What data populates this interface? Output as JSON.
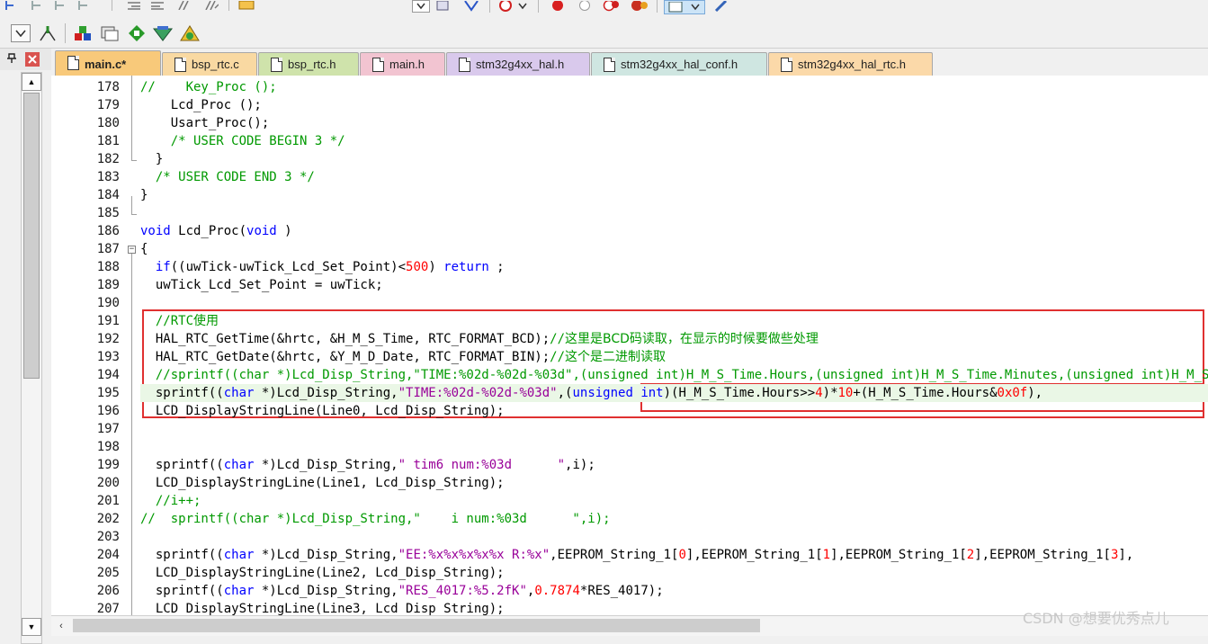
{
  "tabs": [
    {
      "label": "main.c*",
      "color": "#f8c97a",
      "active": true
    },
    {
      "label": "bsp_rtc.c",
      "color": "#f9d9a2",
      "active": false
    },
    {
      "label": "bsp_rtc.h",
      "color": "#cfe3ab",
      "active": false
    },
    {
      "label": "main.h",
      "color": "#f2c4d1",
      "active": false
    },
    {
      "label": "stm32g4xx_hal.h",
      "color": "#d9c9ec",
      "active": false
    },
    {
      "label": "stm32g4xx_hal_conf.h",
      "color": "#cfe6e1",
      "active": false
    },
    {
      "label": "stm32g4xx_hal_rtc.h",
      "color": "#fbd9a9",
      "active": false
    }
  ],
  "lines": [
    {
      "n": "178",
      "html": "<span class=\"cm\">//    Key_Proc ();</span>"
    },
    {
      "n": "179",
      "html": "    Lcd_Proc ();"
    },
    {
      "n": "180",
      "html": "    Usart_Proc();"
    },
    {
      "n": "181",
      "html": "    <span class=\"cm\">/* USER CODE BEGIN 3 */</span>"
    },
    {
      "n": "182",
      "html": "  }"
    },
    {
      "n": "183",
      "html": "  <span class=\"cm\">/* USER CODE END 3 */</span>"
    },
    {
      "n": "184",
      "html": "}"
    },
    {
      "n": "185",
      "html": ""
    },
    {
      "n": "186",
      "html": "<span class=\"kw\">void</span> Lcd_Proc(<span class=\"kw\">void</span> )"
    },
    {
      "n": "187",
      "html": "{"
    },
    {
      "n": "188",
      "html": "  <span class=\"kw\">if</span>((uwTick-uwTick_Lcd_Set_Point)&lt;<span class=\"num\">500</span>) <span class=\"kw\">return</span> ;"
    },
    {
      "n": "189",
      "html": "  uwTick_Lcd_Set_Point = uwTick;"
    },
    {
      "n": "190",
      "html": ""
    },
    {
      "n": "191",
      "html": "  <span class=\"cm\">//RTC<span class=\"cn\">使用</span></span>"
    },
    {
      "n": "192",
      "html": "  HAL_RTC_GetTime(&amp;hrtc, &amp;H_M_S_Time, RTC_FORMAT_BCD);<span class=\"cm\">//<span class=\"cn\">这里是BCD码读取，在显示的时候要做些处理</span></span>"
    },
    {
      "n": "193",
      "html": "  HAL_RTC_GetDate(&amp;hrtc, &amp;Y_M_D_Date, RTC_FORMAT_BIN);<span class=\"cm\">//<span class=\"cn\">这个是二进制读取</span></span>"
    },
    {
      "n": "194",
      "html": "  <span class=\"cm\">//sprintf((char *)Lcd_Disp_String,\"TIME:%02d-%02d-%03d\",(unsigned int)H_M_S_Time.Hours,(unsigned int)H_M_S_Time.Minutes,(unsigned int)H_M_S_Time.Seconds);</span>"
    },
    {
      "n": "195",
      "html": "  sprintf((<span class=\"kw\">char</span> *)Lcd_Disp_String,<span class=\"str\">\"TIME:%02d-%02d-%03d\"</span>,(<span class=\"kw\">unsigned int</span>)(H_M_S_Time.Hours&gt;&gt;<span class=\"num\">4</span>)*<span class=\"num\">10</span>+(H_M_S_Time.Hours&amp;<span class=\"num\">0x0f</span>),"
    },
    {
      "n": "196",
      "html": "  LCD_DisplayStringLine(Line0, Lcd_Disp_String);"
    },
    {
      "n": "197",
      "html": ""
    },
    {
      "n": "198",
      "html": ""
    },
    {
      "n": "199",
      "html": "  sprintf((<span class=\"kw\">char</span> *)Lcd_Disp_String,<span class=\"str\">\" tim6 num:%03d      \"</span>,i);"
    },
    {
      "n": "200",
      "html": "  LCD_DisplayStringLine(Line1, Lcd_Disp_String);"
    },
    {
      "n": "201",
      "html": "  <span class=\"cm\">//i++;</span>"
    },
    {
      "n": "202",
      "html": "<span class=\"cm\">//  sprintf((char *)Lcd_Disp_String,\"    i num:%03d      \",i);</span>"
    },
    {
      "n": "203",
      "html": ""
    },
    {
      "n": "204",
      "html": "  sprintf((<span class=\"kw\">char</span> *)Lcd_Disp_String,<span class=\"str\">\"EE:%x%x%x%x%x R:%x\"</span>,EEPROM_String_1[<span class=\"num\">0</span>],EEPROM_String_1[<span class=\"num\">1</span>],EEPROM_String_1[<span class=\"num\">2</span>],EEPROM_String_1[<span class=\"num\">3</span>],"
    },
    {
      "n": "205",
      "html": "  LCD_DisplayStringLine(Line2, Lcd_Disp_String);"
    },
    {
      "n": "206",
      "html": "  sprintf((<span class=\"kw\">char</span> *)Lcd_Disp_String,<span class=\"str\">\"RES_4017:%5.2fK\"</span>,<span class=\"num\">0.7874</span>*RES_4017);"
    },
    {
      "n": "207",
      "html": "  LCD_DisplayStringLine(Line3, Lcd_Disp_String);"
    }
  ],
  "highlighted_line": "195",
  "watermark": "CSDN @想要优秀点儿",
  "colors": {
    "keyword": "#0000ff",
    "comment": "#009900",
    "string": "#990099",
    "number": "#ff0000",
    "annotation_box": "#e03030"
  }
}
